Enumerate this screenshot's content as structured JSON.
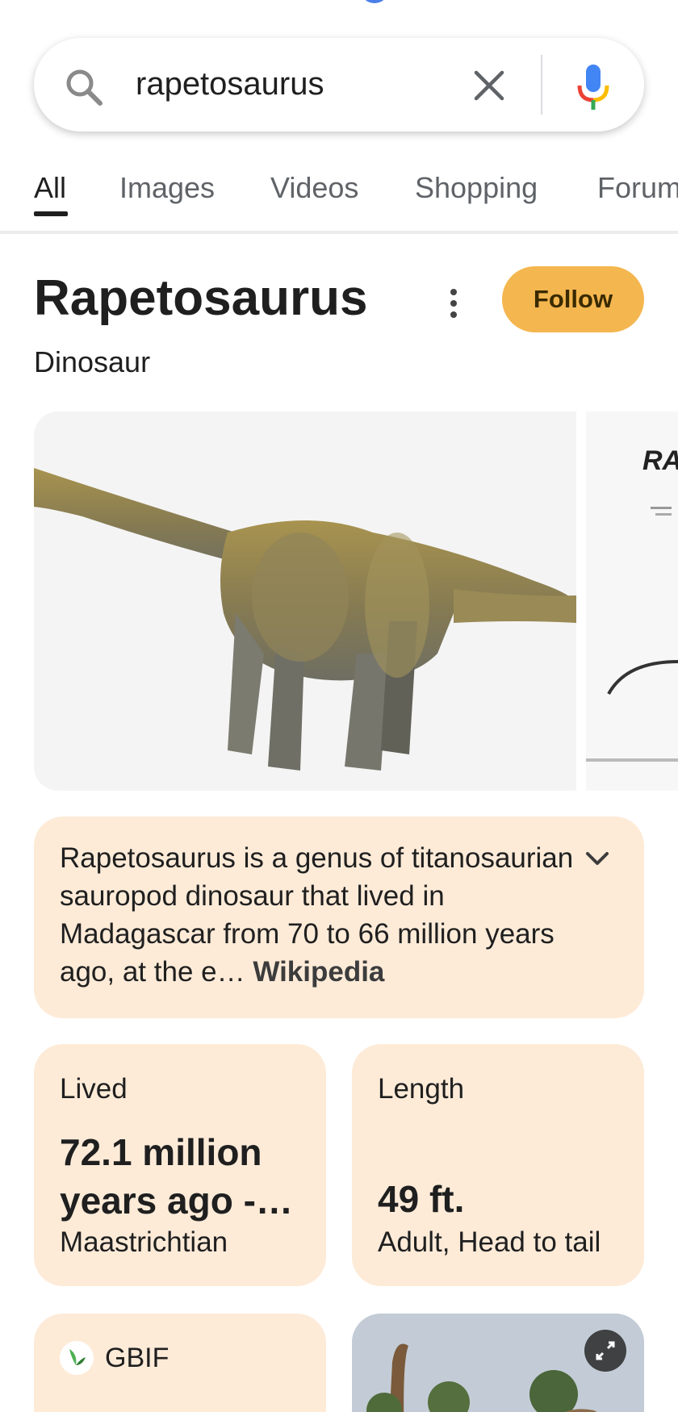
{
  "search": {
    "query": "rapetosaurus",
    "search_icon": "search-icon",
    "clear_icon": "close-icon",
    "mic_icon": "microphone-icon"
  },
  "tabs": [
    {
      "label": "All",
      "active": true
    },
    {
      "label": "Images",
      "active": false
    },
    {
      "label": "Videos",
      "active": false
    },
    {
      "label": "Shopping",
      "active": false
    },
    {
      "label": "Forum",
      "active": false
    }
  ],
  "entity": {
    "title": "Rapetosaurus",
    "subtitle": "Dinosaur",
    "follow_label": "Follow",
    "more_icon": "more-vert-icon"
  },
  "images": {
    "side_label": "RA"
  },
  "description": {
    "text": "Rapetosaurus is a genus of titanosaurian sauropod dinosaur that lived in Madagascar from 70 to 66 million years ago, at the e…",
    "source": "Wikipedia",
    "expand_icon": "chevron-down-icon"
  },
  "facts": [
    {
      "label": "Lived",
      "value": "72.1 million years ago -…",
      "sub": "Maastrichtian"
    },
    {
      "label": "Length",
      "value": "49 ft.",
      "sub": "Adult, Head to tail"
    }
  ],
  "source_card": {
    "label": "GBIF"
  },
  "colors": {
    "follow": "#f4b64f",
    "card": "#fdebd8",
    "accent_blue": "#4a7ee8"
  }
}
